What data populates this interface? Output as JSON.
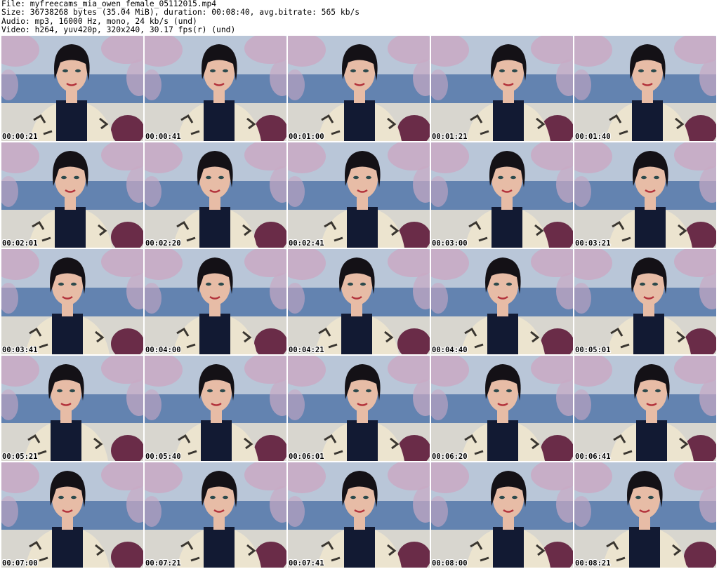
{
  "header": {
    "file_line": "File: myfreecams_mia_owen_female_05112015.mp4",
    "size_line": "Size: 36738268 bytes (35.04 MiB), duration: 00:08:40, avg.bitrate: 565 kb/s",
    "audio_line": "Audio: mp3, 16000 Hz, mono, 24 kb/s (und)",
    "video_line": "Video: h264, yuv420p, 320x240, 30.17 fps(r) (und)"
  },
  "colors": {
    "background": "#ffffff",
    "text": "#000000",
    "scene_sky": "#b9c6d8",
    "scene_water": "#4e72a6",
    "blossom": "#c9a9c4",
    "hair": "#141116",
    "skin": "#e7bca6",
    "top": "#121a33",
    "jacket": "#ece4cf"
  },
  "thumbnails": [
    {
      "time": "00:00:21"
    },
    {
      "time": "00:00:41"
    },
    {
      "time": "00:01:00"
    },
    {
      "time": "00:01:21"
    },
    {
      "time": "00:01:40"
    },
    {
      "time": "00:02:01"
    },
    {
      "time": "00:02:20"
    },
    {
      "time": "00:02:41"
    },
    {
      "time": "00:03:00"
    },
    {
      "time": "00:03:21"
    },
    {
      "time": "00:03:41"
    },
    {
      "time": "00:04:00"
    },
    {
      "time": "00:04:21"
    },
    {
      "time": "00:04:40"
    },
    {
      "time": "00:05:01"
    },
    {
      "time": "00:05:21"
    },
    {
      "time": "00:05:40"
    },
    {
      "time": "00:06:01"
    },
    {
      "time": "00:06:20"
    },
    {
      "time": "00:06:41"
    },
    {
      "time": "00:07:00"
    },
    {
      "time": "00:07:21"
    },
    {
      "time": "00:07:41"
    },
    {
      "time": "00:08:00"
    },
    {
      "time": "00:08:21"
    }
  ]
}
